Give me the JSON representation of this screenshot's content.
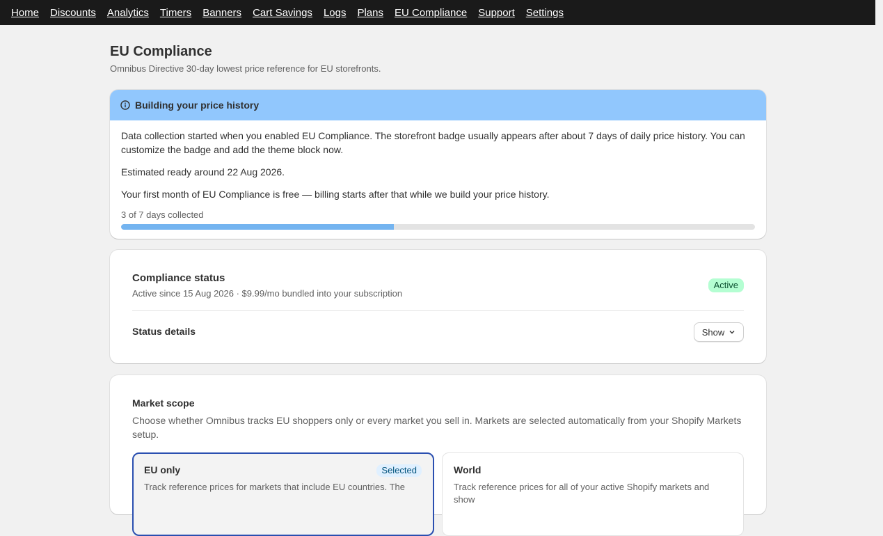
{
  "nav": {
    "items": [
      "Home",
      "Discounts",
      "Analytics",
      "Timers",
      "Banners",
      "Cart Savings",
      "Logs",
      "Plans",
      "EU Compliance",
      "Support",
      "Settings"
    ]
  },
  "header": {
    "title": "EU Compliance",
    "subtitle": "Omnibus Directive 30-day lowest price reference for EU storefronts."
  },
  "banner": {
    "icon": "info-icon",
    "title": "Building your price history",
    "paragraph1": "Data collection started when you enabled EU Compliance. The storefront badge usually appears after about 7 days of daily price history. You can customize the badge and add the theme block now.",
    "paragraph2": "Estimated ready around 22 Aug 2026.",
    "paragraph3": "Your first month of EU Compliance is free — billing starts after that while we build your price history.",
    "progress_label": "3 of 7 days collected",
    "progress_value": 0.43,
    "accent_color": "#91c7fd"
  },
  "status_card": {
    "title": "Compliance status",
    "subtitle": "Active since 15 Aug 2026 · $9.99/mo bundled into your subscription",
    "badge": "Active",
    "details_label": "Status details",
    "show_label": "Show",
    "show_icon": "chevron-down-icon"
  },
  "market_scope": {
    "title": "Market scope",
    "description": "Choose whether Omnibus tracks EU shoppers only or every market you sell in. Markets are selected automatically from your Shopify Markets setup.",
    "options": [
      {
        "title": "EU only",
        "badge": "Selected",
        "text": "Track reference prices for markets that include EU countries. The"
      },
      {
        "title": "World",
        "text": "Track reference prices for all of your active Shopify markets and show"
      }
    ]
  }
}
